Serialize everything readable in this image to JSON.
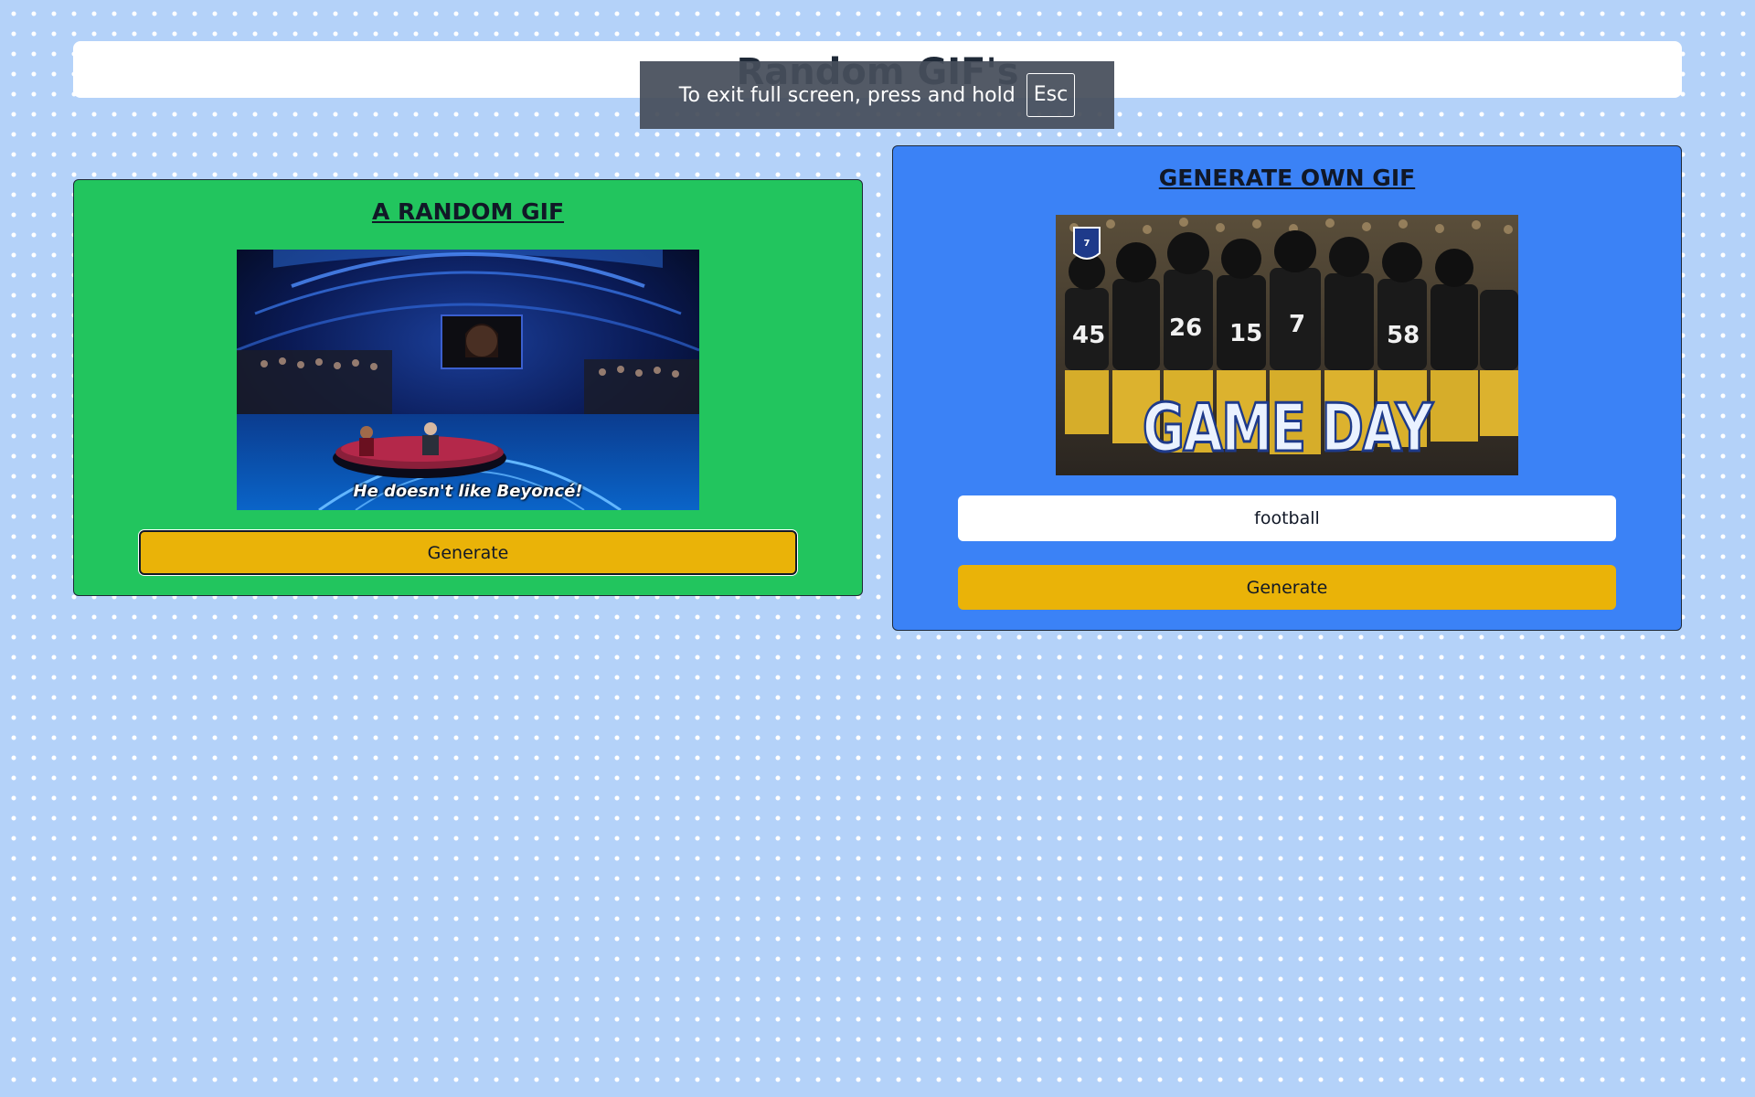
{
  "header": {
    "title": "Random GIF's"
  },
  "fullscreen_notice": {
    "message": "To exit full screen, press and hold",
    "key_label": "Esc"
  },
  "random_card": {
    "title": "A RANDOM GIF",
    "gif_caption": "He doesn't like Beyoncé!",
    "button_label": "Generate"
  },
  "own_card": {
    "title": "GENERATE OWN GIF",
    "gif_overlay_text": "GAME DAY",
    "search_value": "football",
    "button_label": "Generate"
  },
  "colors": {
    "page_background": "#b4d2f9",
    "random_card_background": "#22c55e",
    "own_card_background": "#3b82f6",
    "button_background": "#eab308"
  },
  "icons": {
    "fullscreen_key": "esc-key-icon"
  }
}
